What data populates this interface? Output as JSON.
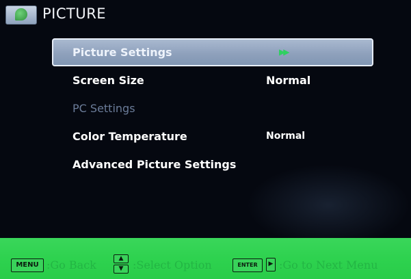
{
  "header": {
    "icon": "picture-menu-icon",
    "title": "PICTURE"
  },
  "menu": {
    "items": [
      {
        "label": "Picture Settings",
        "value": "",
        "indicator": "▶▶",
        "selected": true,
        "disabled": false
      },
      {
        "label": "Screen Size",
        "value": "Normal",
        "selected": false,
        "disabled": false
      },
      {
        "label": "PC Settings",
        "value": "",
        "selected": false,
        "disabled": true
      },
      {
        "label": "Color Temperature",
        "value": "Normal",
        "selected": false,
        "disabled": false
      },
      {
        "label": "Advanced Picture Settings",
        "value": "",
        "selected": false,
        "disabled": false
      }
    ]
  },
  "footer": {
    "menu_key": "MENU",
    "go_back": ":Go Back",
    "up_icon": "▲",
    "down_icon": "▼",
    "select_option": ":Select Option",
    "enter_key": "ENTER",
    "right_icon": "▶",
    "next_menu": ":Go to Next Menu"
  },
  "colors": {
    "background": "#050810",
    "selection": "#9aacc6",
    "footer": "#2ed24f",
    "indicator": "#2fd061",
    "disabled_text": "#6b7c99"
  }
}
